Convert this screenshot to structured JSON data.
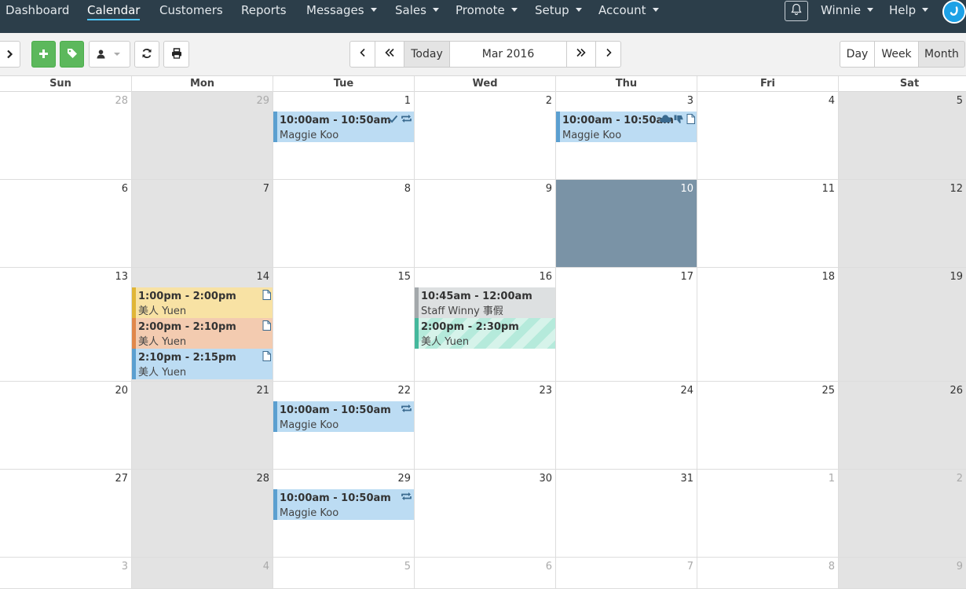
{
  "nav": {
    "items": [
      {
        "label": "Dashboard",
        "active": false,
        "dropdown": false
      },
      {
        "label": "Calendar",
        "active": true,
        "dropdown": false
      },
      {
        "label": "Customers",
        "active": false,
        "dropdown": false
      },
      {
        "label": "Reports",
        "active": false,
        "dropdown": false
      },
      {
        "label": "Messages",
        "active": false,
        "dropdown": true
      },
      {
        "label": "Sales",
        "active": false,
        "dropdown": true
      },
      {
        "label": "Promote",
        "active": false,
        "dropdown": true
      },
      {
        "label": "Setup",
        "active": false,
        "dropdown": true
      },
      {
        "label": "Account",
        "active": false,
        "dropdown": true
      }
    ],
    "user": "Winnie",
    "help": "Help",
    "bell_icon": "bell-icon",
    "logo_icon": "brand-logo-icon"
  },
  "toolbar": {
    "today_label": "Today",
    "period": "Mar 2016",
    "views": [
      {
        "label": "Day",
        "active": false
      },
      {
        "label": "Week",
        "active": false
      },
      {
        "label": "Month",
        "active": true
      }
    ],
    "icons": {
      "expand": "chevron-right-icon",
      "add": "plus-icon",
      "tag": "tag-icon",
      "staff": "user-icon",
      "refresh": "refresh-icon",
      "print": "print-icon",
      "prev": "chevron-left-icon",
      "prev_far": "double-chevron-left-icon",
      "next_far": "double-chevron-right-icon",
      "next": "chevron-right-icon"
    }
  },
  "calendar": {
    "day_headers": [
      "Sun",
      "Mon",
      "Tue",
      "Wed",
      "Thu",
      "Fri",
      "Sat"
    ],
    "weeks": [
      {
        "days": [
          {
            "num": "28",
            "other": true
          },
          {
            "num": "29",
            "other": true
          },
          {
            "num": "1",
            "other": false
          },
          {
            "num": "2",
            "other": false
          },
          {
            "num": "3",
            "other": false
          },
          {
            "num": "4",
            "other": false
          },
          {
            "num": "5",
            "other": false
          }
        ]
      },
      {
        "days": [
          {
            "num": "6",
            "other": false
          },
          {
            "num": "7",
            "other": false
          },
          {
            "num": "8",
            "other": false
          },
          {
            "num": "9",
            "other": false
          },
          {
            "num": "10",
            "other": false,
            "today": true
          },
          {
            "num": "11",
            "other": false
          },
          {
            "num": "12",
            "other": false
          }
        ]
      },
      {
        "days": [
          {
            "num": "13",
            "other": false
          },
          {
            "num": "14",
            "other": false
          },
          {
            "num": "15",
            "other": false
          },
          {
            "num": "16",
            "other": false
          },
          {
            "num": "17",
            "other": false
          },
          {
            "num": "18",
            "other": false
          },
          {
            "num": "19",
            "other": false
          }
        ]
      },
      {
        "days": [
          {
            "num": "20",
            "other": false
          },
          {
            "num": "21",
            "other": false
          },
          {
            "num": "22",
            "other": false
          },
          {
            "num": "23",
            "other": false
          },
          {
            "num": "24",
            "other": false
          },
          {
            "num": "25",
            "other": false
          },
          {
            "num": "26",
            "other": false
          }
        ]
      },
      {
        "days": [
          {
            "num": "27",
            "other": false
          },
          {
            "num": "28",
            "other": false
          },
          {
            "num": "29",
            "other": false
          },
          {
            "num": "30",
            "other": false
          },
          {
            "num": "31",
            "other": false
          },
          {
            "num": "1",
            "other": true
          },
          {
            "num": "2",
            "other": true
          }
        ]
      },
      {
        "days": [
          {
            "num": "3",
            "other": true
          },
          {
            "num": "4",
            "other": true
          },
          {
            "num": "5",
            "other": true
          },
          {
            "num": "6",
            "other": true
          },
          {
            "num": "7",
            "other": true
          },
          {
            "num": "8",
            "other": true
          },
          {
            "num": "9",
            "other": true
          }
        ]
      }
    ],
    "events": [
      {
        "week": 0,
        "day": 2,
        "slot": 0,
        "time": "10:00am - 10:50am",
        "name": "Maggie Koo",
        "style": "blue",
        "icons": [
          "check-icon",
          "repeat-icon"
        ]
      },
      {
        "week": 0,
        "day": 4,
        "slot": 0,
        "time": "10:00am - 10:50am",
        "name": "Maggie Koo",
        "style": "blue",
        "icons": [
          "cloud-icon",
          "thumbs-down-icon",
          "document-icon"
        ]
      },
      {
        "week": 2,
        "day": 1,
        "slot": 0,
        "time": "1:00pm - 2:00pm",
        "name": "美人 Yuen",
        "style": "yellow",
        "icons": [
          "document-icon"
        ]
      },
      {
        "week": 2,
        "day": 1,
        "slot": 1,
        "time": "2:00pm - 2:10pm",
        "name": "美人 Yuen",
        "style": "orange",
        "icons": [
          "document-icon"
        ]
      },
      {
        "week": 2,
        "day": 1,
        "slot": 2,
        "time": "2:10pm - 2:15pm",
        "name": "美人 Yuen",
        "style": "blue",
        "icons": [
          "document-icon"
        ]
      },
      {
        "week": 2,
        "day": 3,
        "slot": 0,
        "time": "10:45am - 12:00am",
        "name": "Staff Winny 事假",
        "style": "grey",
        "icons": []
      },
      {
        "week": 2,
        "day": 3,
        "slot": 1,
        "time": "2:00pm - 2:30pm",
        "name": "美人 Yuen",
        "style": "striped",
        "icons": []
      },
      {
        "week": 3,
        "day": 2,
        "slot": 0,
        "time": "10:00am - 10:50am",
        "name": "Maggie Koo",
        "style": "blue",
        "icons": [
          "repeat-icon"
        ]
      },
      {
        "week": 4,
        "day": 2,
        "slot": 0,
        "time": "10:00am - 10:50am",
        "name": "Maggie Koo",
        "style": "blue",
        "icons": [
          "repeat-icon"
        ]
      }
    ]
  },
  "colors": {
    "nav_bg": "#2c3e4a",
    "active_underline": "#4fc3f7",
    "green_button": "#5cb85c",
    "today_bg": "#7a93a6",
    "shaded_day": "#e3e3e3",
    "event_blue": "#bcdcf3",
    "event_yellow": "#f8e2a4",
    "event_orange": "#f3cbb0",
    "event_grey": "#dde0e1"
  }
}
